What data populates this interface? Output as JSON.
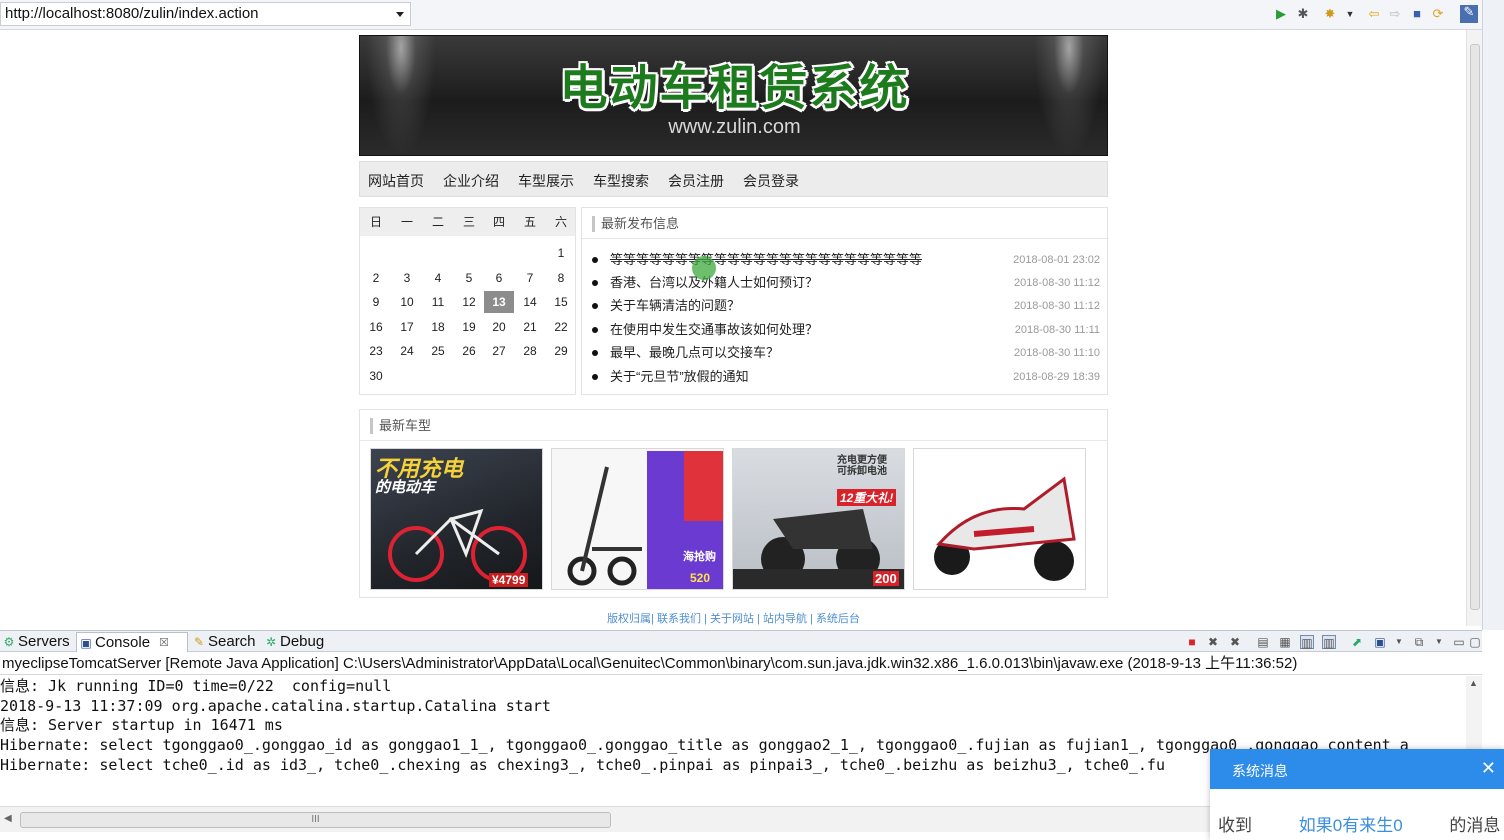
{
  "browser": {
    "url": "http://localhost:8080/zulin/index.action"
  },
  "site": {
    "banner_title": "电动车租赁系统",
    "banner_subtitle": "www.zulin.com",
    "nav": [
      "网站首页",
      "企业介绍",
      "车型展示",
      "车型搜索",
      "会员注册",
      "会员登录"
    ],
    "calendar": {
      "weekdays": [
        "日",
        "一",
        "二",
        "三",
        "四",
        "五",
        "六"
      ],
      "weeks": [
        [
          "",
          "",
          "",
          "",
          "",
          "",
          "1"
        ],
        [
          "2",
          "3",
          "4",
          "5",
          "6",
          "7",
          "8"
        ],
        [
          "9",
          "10",
          "11",
          "12",
          "13",
          "14",
          "15"
        ],
        [
          "16",
          "17",
          "18",
          "19",
          "20",
          "21",
          "22"
        ],
        [
          "23",
          "24",
          "25",
          "26",
          "27",
          "28",
          "29"
        ],
        [
          "30",
          "",
          "",
          "",
          "",
          "",
          ""
        ]
      ],
      "today": "13"
    },
    "news_panel_title": "最新发布信息",
    "news": [
      {
        "title": "等等等等等等等等等等等等等等等等等等等等等等等等",
        "date": "2018-08-01 23:02"
      },
      {
        "title": "香港、台湾以及外籍人士如何预订？",
        "date": "2018-08-30 11:12"
      },
      {
        "title": "关于车辆清洁的问题？",
        "date": "2018-08-30 11:12"
      },
      {
        "title": "在使用中发生交通事故该如何处理？",
        "date": "2018-08-30 11:11"
      },
      {
        "title": "最早、最晚几点可以交接车？",
        "date": "2018-08-30 11:10"
      },
      {
        "title": "关于“元旦节”放假的通知",
        "date": "2018-08-29 18:39"
      }
    ],
    "cars_panel_title": "最新车型",
    "car_captions": {
      "car1_main": "不用充电",
      "car1_sub": "的电动车",
      "car1_price": "¥4799",
      "car3_top": "充电更方便",
      "car3_top2": "可拆卸电池",
      "car3_gift": "12重大礼!",
      "car3_price": "200",
      "car2_badge": "海抢购",
      "car2_price": "520"
    },
    "footer_links": [
      "版权归属",
      "联系我们",
      "关于网站",
      "站内导航",
      "系统后台"
    ]
  },
  "console": {
    "tabs": [
      "Servers",
      "Console",
      "Search",
      "Debug"
    ],
    "description": "myeclipseTomcatServer [Remote Java Application] C:\\Users\\Administrator\\AppData\\Local\\Genuitec\\Common\\binary\\com.sun.java.jdk.win32.x86_1.6.0.013\\bin\\javaw.exe (2018-9-13 上午11:36:52)",
    "lines": [
      "信息: Jk running ID=0 time=0/22  config=null",
      "2018-9-13 11:37:09 org.apache.catalina.startup.Catalina start",
      "信息: Server startup in 16471 ms",
      "Hibernate: select tgonggao0_.gonggao_id as gonggao1_1_, tgonggao0_.gonggao_title as gonggao2_1_, tgonggao0_.fujian as fujian1_, tgonggao0_.gonggao_content a",
      "Hibernate: select tche0_.id as id3_, tche0_.chexing as chexing3_, tche0_.pinpai as pinpai3_, tche0_.beizhu as beizhu3_, tche0_.fu"
    ],
    "hscroll_grip": "III"
  },
  "popup": {
    "title": "系统消息",
    "close": "✕",
    "body_prefix": "收到",
    "body_link": "如果0有来生0",
    "body_suffix": "的消息"
  },
  "colors": {
    "accent": "#2d8bea",
    "banner_title": "#1d7a1d",
    "footer_link": "#4e8fd0"
  }
}
